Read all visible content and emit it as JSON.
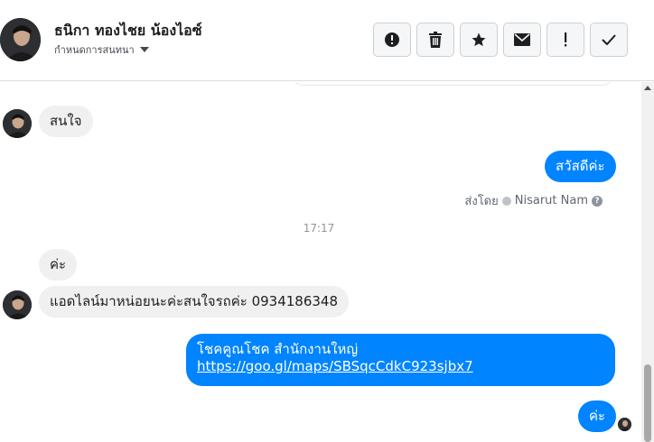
{
  "header": {
    "name": "ธนิกา ทองไชย น้องไอซ์",
    "settings_label": "กำหนดการสนทนา",
    "toolbar": [
      {
        "name": "report-button",
        "icon": "alert-circle-icon"
      },
      {
        "name": "delete-button",
        "icon": "trash-icon"
      },
      {
        "name": "star-button",
        "icon": "star-icon"
      },
      {
        "name": "mark-unread-button",
        "icon": "envelope-icon"
      },
      {
        "name": "spam-button",
        "icon": "exclamation-icon"
      },
      {
        "name": "done-button",
        "icon": "checkmark-icon"
      }
    ]
  },
  "messages": {
    "m1": "สนใจ",
    "m2": "สวัสดีค่ะ",
    "sent_by_label": "ส่งโดย",
    "sent_by_name": "Nisarut Nam",
    "help_glyph": "?",
    "time": "17:17",
    "m3": "ค่ะ",
    "m4": "แอดไลน์มาหน่อยนะค่ะสนใจรถค่ะ 0934186348",
    "m5_line1": "โชคคูณโชค สำนักงานใหญ่",
    "m5_link": "https://goo.gl/maps/SBSqcCdkC923sjbx7",
    "m6": "ค่ะ"
  },
  "colors": {
    "outgoing_bubble": "#0084ff",
    "incoming_bubble": "#f0f0f0",
    "divider": "#dadde1"
  }
}
